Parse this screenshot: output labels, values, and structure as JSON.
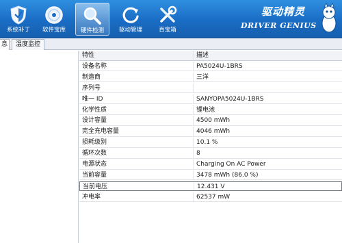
{
  "toolbar": {
    "items": [
      {
        "label": "系统补丁",
        "icon": "shield-icon"
      },
      {
        "label": "软件宝库",
        "icon": "disc-icon"
      },
      {
        "label": "硬件检测",
        "icon": "magnifier-icon"
      },
      {
        "label": "驱动管理",
        "icon": "refresh-icon"
      },
      {
        "label": "百宝箱",
        "icon": "tools-icon"
      }
    ],
    "brand_cn": "驱动精灵",
    "brand_en": "DRIVER GENIUS",
    "accent": "#1a6cc4"
  },
  "tabs": {
    "first": "息",
    "second": "温度监控"
  },
  "grid": {
    "header": {
      "key": "特性",
      "value": "描述"
    },
    "rows": [
      {
        "key": "设备名称",
        "value": "PA5024U-1BRS"
      },
      {
        "key": "制造商",
        "value": "三洋"
      },
      {
        "key": "序列号",
        "value": ""
      },
      {
        "key": "唯一 ID",
        "value": "SANYOPA5024U-1BRS"
      },
      {
        "key": "化学性质",
        "value": "锂电池"
      },
      {
        "key": "设计容量",
        "value": "4500 mWh"
      },
      {
        "key": "完全充电容量",
        "value": "4046 mWh"
      },
      {
        "key": "损耗级别",
        "value": "10.1 %"
      },
      {
        "key": "循环次数",
        "value": "8"
      },
      {
        "key": "电源状态",
        "value": "Charging On AC Power"
      },
      {
        "key": "当前容量",
        "value": "3478 mWh (86.0 %)"
      },
      {
        "key": "当前电压",
        "value": "12.431 V"
      },
      {
        "key": "冲电率",
        "value": "62537 mW"
      }
    ]
  }
}
